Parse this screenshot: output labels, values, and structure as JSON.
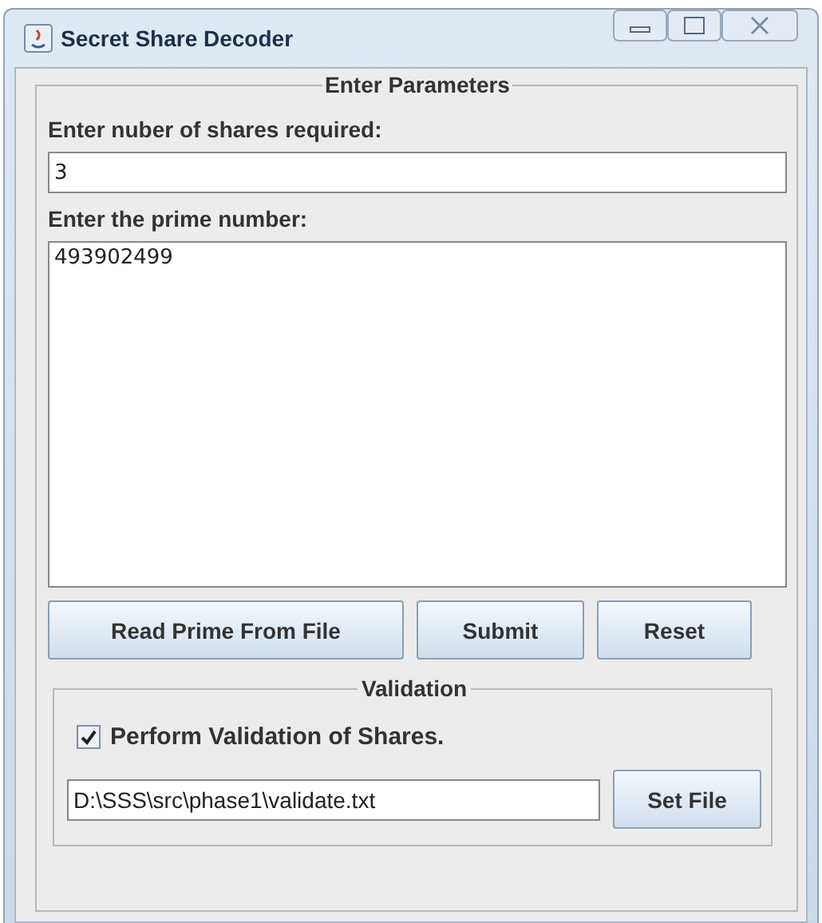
{
  "window": {
    "title": "Secret Share Decoder"
  },
  "parameters": {
    "legend": "Enter Parameters",
    "shares_label": "Enter nuber of shares required:",
    "shares_value": "3",
    "prime_label": "Enter the prime number:",
    "prime_value": "493902499",
    "buttons": [
      "Read Prime From File",
      "Submit",
      "Reset"
    ]
  },
  "validation": {
    "legend": "Validation",
    "checkbox": {
      "label": "Perform Validation of Shares.",
      "checked": true
    },
    "file_path": "D:\\SSS\\src\\phase1\\validate.txt",
    "button": "Set File"
  }
}
